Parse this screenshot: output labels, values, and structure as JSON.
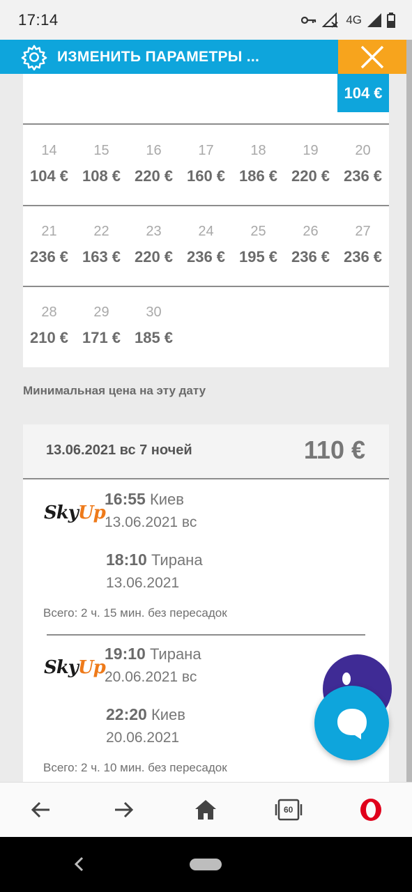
{
  "status_bar": {
    "time": "17:14",
    "network": "4G",
    "icons": [
      "key-icon",
      "wifi-off-icon",
      "signal-icon",
      "battery-icon"
    ]
  },
  "top_bar": {
    "title": "ИЗМЕНИТЬ ПАРАМЕТРЫ ...",
    "accent_color": "#0ea5dc",
    "close_color": "#f7a41d"
  },
  "calendar": {
    "selected_price": "104 €",
    "weeks": [
      [
        {
          "day": "14",
          "price": "104 €"
        },
        {
          "day": "15",
          "price": "108 €"
        },
        {
          "day": "16",
          "price": "220 €"
        },
        {
          "day": "17",
          "price": "160 €"
        },
        {
          "day": "18",
          "price": "186 €"
        },
        {
          "day": "19",
          "price": "220 €"
        },
        {
          "day": "20",
          "price": "236 €"
        }
      ],
      [
        {
          "day": "21",
          "price": "236 €"
        },
        {
          "day": "22",
          "price": "163 €"
        },
        {
          "day": "23",
          "price": "220 €"
        },
        {
          "day": "24",
          "price": "236 €"
        },
        {
          "day": "25",
          "price": "195 €"
        },
        {
          "day": "26",
          "price": "236 €"
        },
        {
          "day": "27",
          "price": "236 €"
        }
      ],
      [
        {
          "day": "28",
          "price": "210 €"
        },
        {
          "day": "29",
          "price": "171 €"
        },
        {
          "day": "30",
          "price": "185 €"
        }
      ]
    ]
  },
  "min_price_label": "Минимальная цена на эту дату",
  "offer": {
    "date_text": "13.06.2021 вс 7 ночей",
    "price": "110 €",
    "flights": [
      {
        "airline_logo": {
          "part1": "Sky",
          "part2": "Up"
        },
        "depart": {
          "time": "16:55",
          "city": "Киев",
          "date": "13.06.2021 вс"
        },
        "arrive": {
          "time": "18:10",
          "city": "Тирана",
          "date": "13.06.2021"
        },
        "total": "Всего: 2 ч. 15 мин. без пересадок"
      },
      {
        "airline_logo": {
          "part1": "Sky",
          "part2": "Up"
        },
        "depart": {
          "time": "19:10",
          "city": "Тирана",
          "date": "20.06.2021 вс"
        },
        "arrive": {
          "time": "22:20",
          "city": "Киев",
          "date": "20.06.2021"
        },
        "total": "Всего: 2 ч. 10 мин. без пересадок"
      }
    ]
  },
  "browser_nav": {
    "items": [
      "back-arrow-icon",
      "forward-arrow-icon",
      "home-icon",
      "tabs-icon",
      "opera-icon"
    ],
    "tabs_count": "60"
  }
}
